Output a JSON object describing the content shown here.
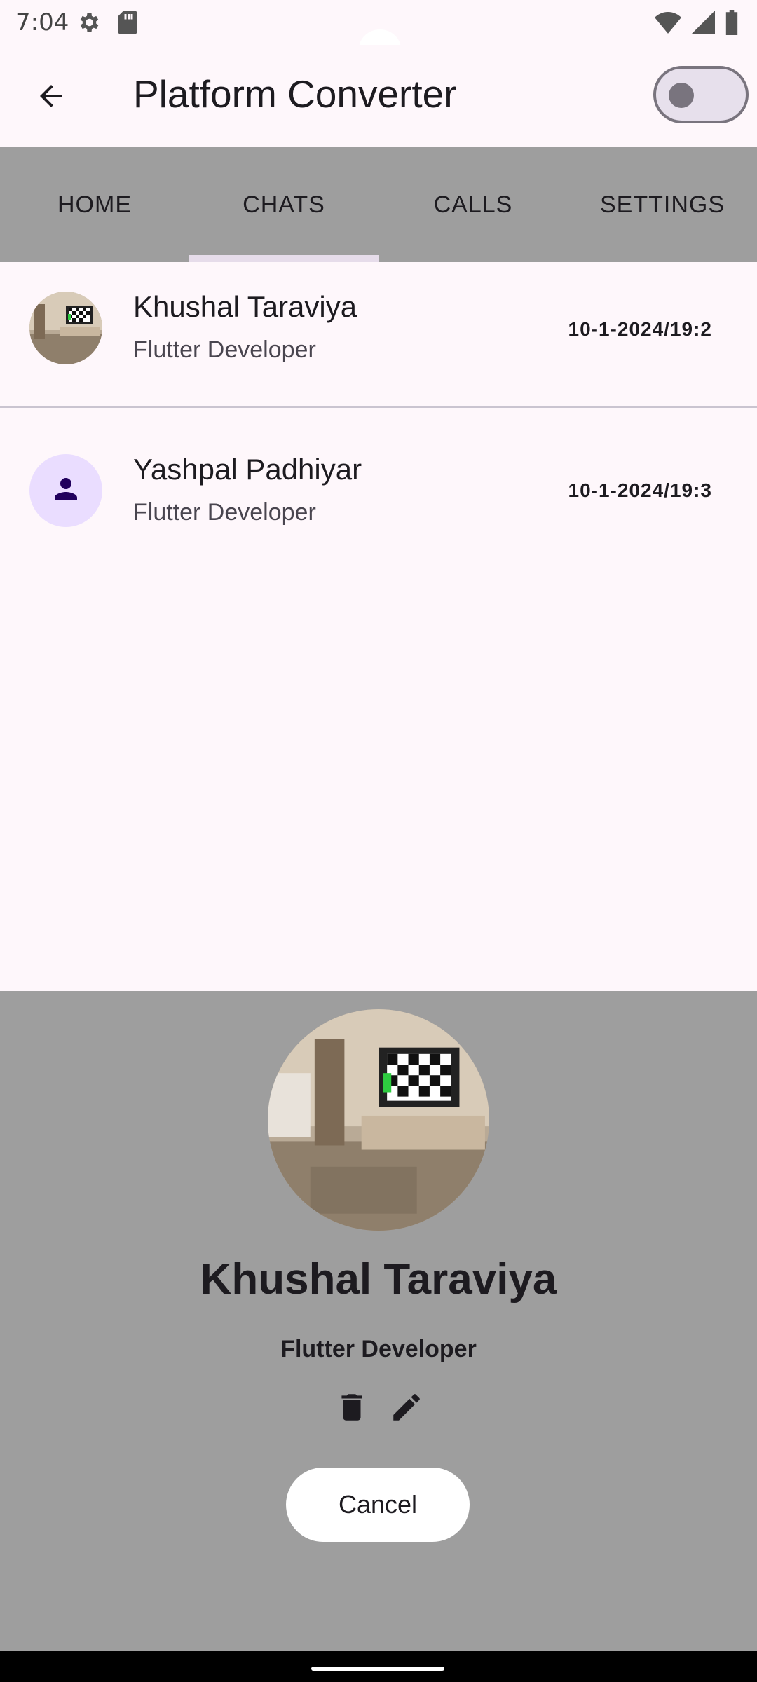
{
  "status_bar": {
    "time": "7:04",
    "icons_left": [
      "gear-icon",
      "sd-card-icon"
    ],
    "icons_right": [
      "wifi-icon",
      "signal-icon",
      "battery-icon"
    ]
  },
  "app_bar": {
    "title": "Platform Converter",
    "toggle_on": false
  },
  "tabs": [
    {
      "label": "HOME",
      "selected": false
    },
    {
      "label": "CHATS",
      "selected": true
    },
    {
      "label": "CALLS",
      "selected": false
    },
    {
      "label": "SETTINGS",
      "selected": false
    }
  ],
  "chats": [
    {
      "name": "Khushal Taraviya",
      "subtitle": "Flutter Developer",
      "time": "10-1-2024/19:2",
      "avatar": "photo"
    },
    {
      "name": "Yashpal Padhiyar",
      "subtitle": "Flutter Developer",
      "time": "10-1-2024/19:3",
      "avatar": "person-icon"
    }
  ],
  "sheet": {
    "name": "Khushal Taraviya",
    "role": "Flutter Developer",
    "cancel_label": "Cancel",
    "actions": [
      "delete-icon",
      "edit-icon"
    ]
  },
  "colors": {
    "background": "#fef7fb",
    "tab_bar": "#9e9e9e",
    "sheet": "#9e9e9e",
    "avatar_placeholder": "#eaddff",
    "avatar_icon": "#21005d"
  }
}
